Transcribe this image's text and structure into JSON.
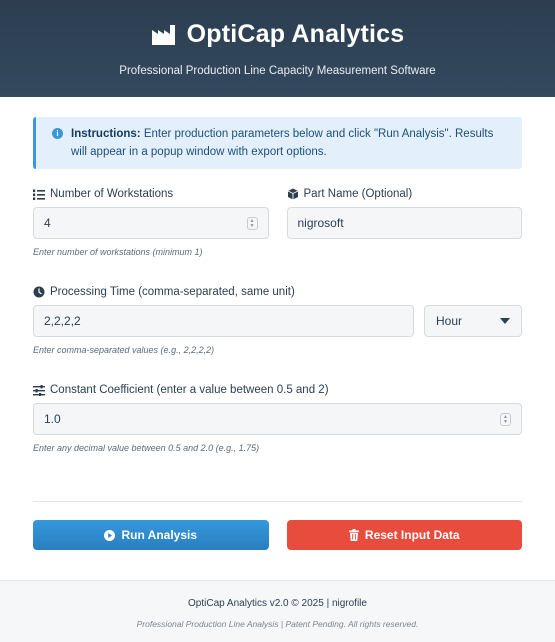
{
  "header": {
    "title": "OptiCap Analytics",
    "subtitle": "Professional Production Line Capacity Measurement Software"
  },
  "info": {
    "label": "Instructions:",
    "text": "Enter production parameters below and click \"Run Analysis\". Results will appear in a popup window with export options."
  },
  "workstations": {
    "label": "Number of Workstations",
    "value": "4",
    "hint": "Enter number of workstations (minimum 1)"
  },
  "part_name": {
    "label": "Part Name (Optional)",
    "value": "nigrosoft"
  },
  "processing_time": {
    "label": "Processing Time (comma-separated, same unit)",
    "value": "2,2,2,2",
    "unit": "Hour",
    "hint": "Enter comma-separated values (e.g., 2,2,2,2)"
  },
  "coefficient": {
    "label": "Constant Coefficient (enter a value between 0.5 and 2)",
    "value": "1.0",
    "hint": "Enter any decimal value between 0.5 and 2.0 (e.g., 1.75)"
  },
  "buttons": {
    "run": "Run Analysis",
    "reset": "Reset Input Data"
  },
  "footer": {
    "line1": "OptiCap Analytics v2.0 © 2025 | nigrofile",
    "line2": "Professional Production Line Analysis | Patent Pending. All rights reserved."
  },
  "colors": {
    "header": "#2c3e50",
    "primary": "#3498db",
    "danger": "#e74c3c"
  }
}
